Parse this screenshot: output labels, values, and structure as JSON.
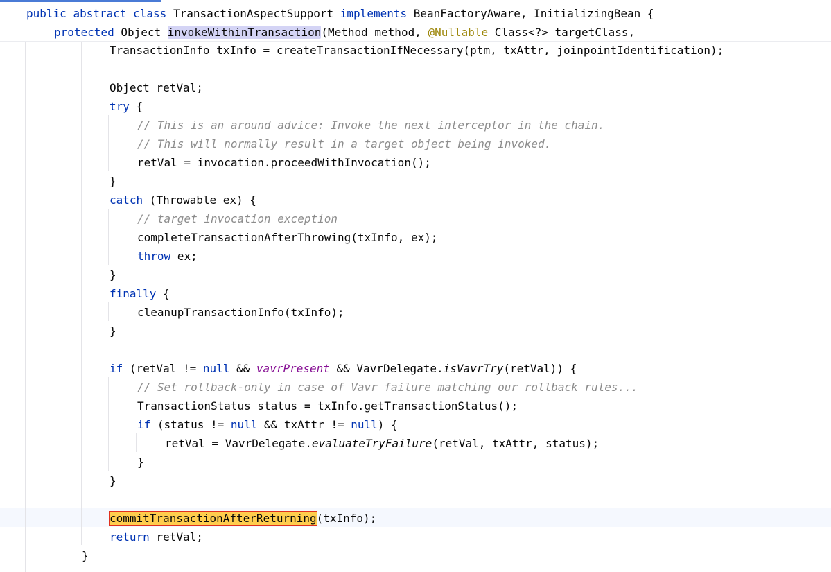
{
  "editor": {
    "sticky": {
      "class_decl": {
        "kw_public": "public",
        "kw_abstract": "abstract",
        "kw_class": "class",
        "class_name": "TransactionAspectSupport",
        "kw_implements": "implements",
        "interfaces": "BeanFactoryAware, InitializingBean {"
      },
      "method_decl": {
        "kw_protected": "protected",
        "return_type": "Object",
        "method_name": "invokeWithinTransaction",
        "params_start": "(Method method, ",
        "annotation": "@Nullable",
        "params_end": " Class<?> targetClass,"
      }
    },
    "lines": {
      "l1": "TransactionInfo txInfo = createTransactionIfNecessary(ptm, txAttr, joinpointIdentification);",
      "l3": "Object retVal;",
      "l4_kw": "try",
      "l4_rest": " {",
      "l5": "// This is an around advice: Invoke the next interceptor in the chain.",
      "l6": "// This will normally result in a target object being invoked.",
      "l7": "retVal = invocation.proceedWithInvocation();",
      "l8": "}",
      "l9_kw": "catch",
      "l9_rest": " (Throwable ex) {",
      "l10": "// target invocation exception",
      "l11": "completeTransactionAfterThrowing(txInfo, ex);",
      "l12_kw": "throw",
      "l12_rest": " ex;",
      "l13": "}",
      "l14_kw": "finally",
      "l14_rest": " {",
      "l15": "cleanupTransactionInfo(txInfo);",
      "l16": "}",
      "l18": {
        "kw_if": "if",
        "p1": " (retVal != ",
        "kw_null": "null",
        "p2": " && ",
        "field": "vavrPresent",
        "p3": " && VavrDelegate.",
        "static_call": "isVavrTry",
        "p4": "(retVal)) {"
      },
      "l19": "// Set rollback-only in case of Vavr failure matching our rollback rules...",
      "l20": "TransactionStatus status = txInfo.getTransactionStatus();",
      "l21": {
        "kw_if": "if",
        "p1": " (status != ",
        "kw_null1": "null",
        "p2": " && txAttr != ",
        "kw_null2": "null",
        "p3": ") {"
      },
      "l22": {
        "p1": "retVal = VavrDelegate.",
        "static_call": "evaluateTryFailure",
        "p2": "(retVal, txAttr, status);"
      },
      "l23": "}",
      "l24": "}",
      "l26": {
        "highlight": "commitTransactionAfterReturning",
        "rest": "(txInfo);"
      },
      "l27_kw": "return",
      "l27_rest": " retVal;",
      "l28": "}"
    }
  },
  "colors": {
    "keyword": "#0033b3",
    "comment": "#8c8c8c",
    "annotation": "#9e880d",
    "field": "#871094",
    "usage_highlight": "#d4d4f5",
    "search_highlight": "#ffcd4d",
    "search_border": "#e0301e",
    "caret_row": "#f5f8fe"
  }
}
